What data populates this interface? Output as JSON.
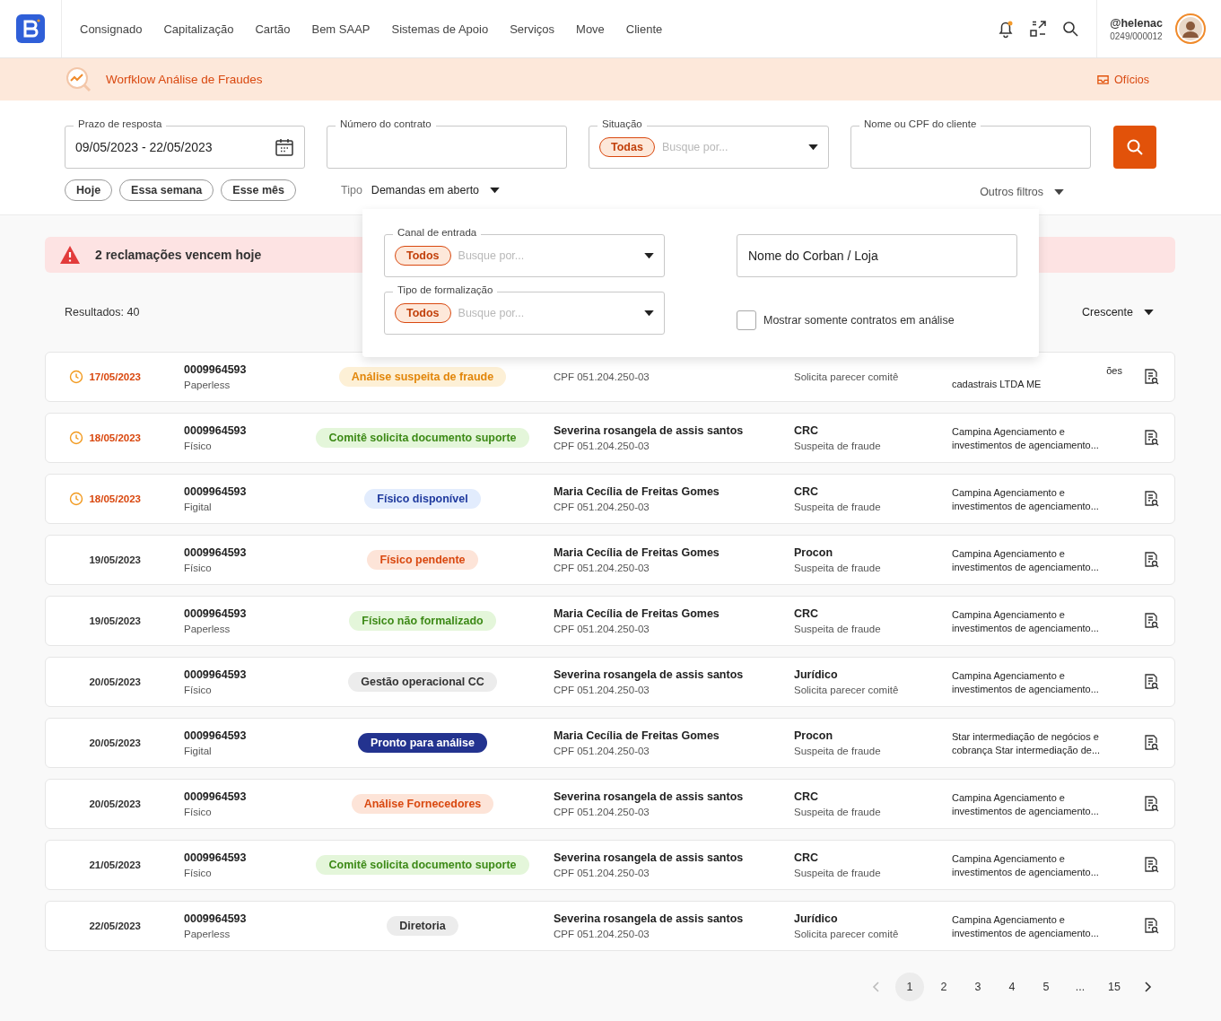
{
  "nav": {
    "items": [
      "Consignado",
      "Capitalização",
      "Cartão",
      "Bem SAAP",
      "Sistemas de Apoio",
      "Serviços",
      "Move",
      "Cliente"
    ],
    "notification_dot": true,
    "user": {
      "handle": "@helenac",
      "code": "0249/000012"
    }
  },
  "banner": {
    "title": "Worfklow Análise de Fraudes",
    "action": "Ofícios"
  },
  "filters": {
    "date": {
      "label": "Prazo de resposta",
      "value": "09/05/2023 - 22/05/2023"
    },
    "contract": {
      "label": "Número do contrato"
    },
    "situacao": {
      "label": "Situação",
      "chip": "Todas",
      "placeholder": "Busque por..."
    },
    "client": {
      "label": "Nome ou CPF do cliente"
    },
    "quick": [
      {
        "label": "Hoje",
        "selected": false
      },
      {
        "label": "Essa semana",
        "selected": false
      },
      {
        "label": "Esse mês",
        "selected": false
      }
    ],
    "tipo": {
      "label": "Tipo",
      "value": "Demandas em aberto"
    },
    "more": "Outros filtros"
  },
  "more_filters": {
    "canal": {
      "label": "Canal de entrada",
      "chip": "Todos",
      "placeholder": "Busque por..."
    },
    "formalizacao": {
      "label": "Tipo de formalização",
      "chip": "Todos",
      "placeholder": "Busque por..."
    },
    "corban": {
      "placeholder": "Nome do Corban / Loja"
    },
    "only_analysis": {
      "label": "Mostrar somente contratos em análise",
      "checked": false
    }
  },
  "alert": "2 reclamações vencem hoje",
  "results": "Resultados: 40",
  "sort": "Crescente",
  "rows": [
    {
      "date": "17/05/2023",
      "urgent": true,
      "contract": "0009964593",
      "format": "Paperless",
      "status": "Análise suspeita de fraude",
      "kind": "warning",
      "cpf": "CPF 051.204.250-03",
      "reason": "Solicita parecer comitê",
      "corban": [
        "ões",
        "cadastrais LTDA ME"
      ],
      "first_line_clipped": true
    },
    {
      "date": "18/05/2023",
      "urgent": true,
      "contract": "0009964593",
      "format": "Físico",
      "status": "Comitê solicita documento suporte",
      "kind": "success",
      "name": "Severina rosangela de assis santos",
      "cpf": "CPF 051.204.250-03",
      "category": "CRC",
      "reason": "Suspeita de fraude",
      "corban": [
        "Campina Agenciamento e",
        "investimentos de agenciamento..."
      ],
      "first_line_clipped": false
    },
    {
      "date": "18/05/2023",
      "urgent": true,
      "contract": "0009964593",
      "format": "Figital",
      "status": "Físico disponível",
      "kind": "info",
      "name": "Maria Cecília de Freitas Gomes",
      "cpf": "CPF 051.204.250-03",
      "category": "CRC",
      "reason": "Suspeita de fraude",
      "corban": [
        "Campina Agenciamento e",
        "investimentos de agenciamento..."
      ],
      "first_line_clipped": false
    },
    {
      "date": "19/05/2023",
      "urgent": false,
      "contract": "0009964593",
      "format": "Físico",
      "status": "Físico pendente",
      "kind": "danger",
      "name": "Maria Cecília de Freitas Gomes",
      "cpf": "CPF 051.204.250-03",
      "category": "Procon",
      "reason": "Suspeita de fraude",
      "corban": [
        "Campina Agenciamento e",
        "investimentos de agenciamento..."
      ],
      "first_line_clipped": false
    },
    {
      "date": "19/05/2023",
      "urgent": false,
      "contract": "0009964593",
      "format": "Paperless",
      "status": "Físico não formalizado",
      "kind": "success",
      "name": "Maria Cecília de Freitas Gomes",
      "cpf": "CPF 051.204.250-03",
      "category": "CRC",
      "reason": "Suspeita de fraude",
      "corban": [
        "Campina Agenciamento e",
        "investimentos de agenciamento..."
      ],
      "first_line_clipped": false
    },
    {
      "date": "20/05/2023",
      "urgent": false,
      "contract": "0009964593",
      "format": "Físico",
      "status": "Gestão operacional CC",
      "kind": "neutral",
      "name": "Severina rosangela de assis santos",
      "cpf": "CPF 051.204.250-03",
      "category": "Jurídico",
      "reason": "Solicita parecer comitê",
      "corban": [
        "Campina Agenciamento e",
        "investimentos de agenciamento..."
      ],
      "first_line_clipped": false
    },
    {
      "date": "20/05/2023",
      "urgent": false,
      "contract": "0009964593",
      "format": "Figital",
      "status": "Pronto para análise",
      "kind": "primary",
      "name": "Maria Cecília de Freitas Gomes",
      "cpf": "CPF 051.204.250-03",
      "category": "Procon",
      "reason": "Suspeita de fraude",
      "corban": [
        "Star intermediação de negócios e",
        "cobrança Star intermediação de..."
      ],
      "first_line_clipped": false
    },
    {
      "date": "20/05/2023",
      "urgent": false,
      "contract": "0009964593",
      "format": "Físico",
      "status": "Análise Fornecedores",
      "kind": "danger",
      "name": "Severina rosangela de assis santos",
      "cpf": "CPF 051.204.250-03",
      "category": "CRC",
      "reason": "Suspeita de fraude",
      "corban": [
        "Campina Agenciamento e",
        "investimentos de agenciamento..."
      ],
      "first_line_clipped": false
    },
    {
      "date": "21/05/2023",
      "urgent": false,
      "contract": "0009964593",
      "format": "Físico",
      "status": "Comitê solicita documento suporte",
      "kind": "success",
      "name": "Severina rosangela de assis santos",
      "cpf": "CPF 051.204.250-03",
      "category": "CRC",
      "reason": "Suspeita de fraude",
      "corban": [
        "Campina Agenciamento e",
        "investimentos de agenciamento..."
      ],
      "first_line_clipped": false
    },
    {
      "date": "22/05/2023",
      "urgent": false,
      "contract": "0009964593",
      "format": "Paperless",
      "status": "Diretoria",
      "kind": "neutral",
      "name": "Severina rosangela de assis santos",
      "cpf": "CPF 051.204.250-03",
      "category": "Jurídico",
      "reason": "Solicita parecer comitê",
      "corban": [
        "Campina Agenciamento e",
        "investimentos de agenciamento..."
      ],
      "first_line_clipped": false
    }
  ],
  "pagination": {
    "pages": [
      {
        "label": "1",
        "selected": true
      },
      {
        "label": "2",
        "selected": false
      },
      {
        "label": "3",
        "selected": false
      },
      {
        "label": "4",
        "selected": false
      },
      {
        "label": "5",
        "selected": false
      },
      {
        "label": "...",
        "selected": false
      },
      {
        "label": "15",
        "selected": false
      }
    ],
    "prev_disabled": true
  }
}
